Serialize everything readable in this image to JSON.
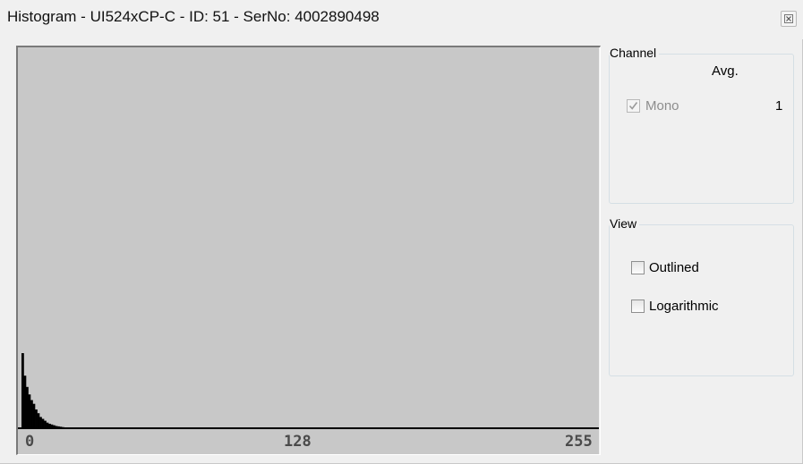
{
  "window": {
    "title": "Histogram - UI524xCP-C - ID: 51 - SerNo: 4002890498",
    "close_icon": "close-icon"
  },
  "histogram": {
    "axis_labels": [
      "0",
      "128",
      "255"
    ],
    "background_color": "#c8c8c8",
    "bar_color": "#000000",
    "chart_data": {
      "type": "bar",
      "x_range": [
        0,
        255
      ],
      "series": [
        {
          "values": [
            0.2,
            0.14,
            0.11,
            0.09,
            0.075,
            0.065,
            0.05,
            0.04,
            0.03,
            0.025,
            0.02,
            0.015,
            0.012,
            0.01,
            0.008,
            0.006,
            0.005,
            0.004,
            0.003,
            0.002
          ]
        }
      ]
    }
  },
  "channel": {
    "title": "Channel",
    "avg_header": "Avg.",
    "mono_label": "Mono",
    "mono_checked": true,
    "mono_value": "1"
  },
  "view": {
    "title": "View",
    "outlined_label": "Outlined",
    "outlined_checked": false,
    "logarithmic_label": "Logarithmic",
    "logarithmic_checked": false
  }
}
